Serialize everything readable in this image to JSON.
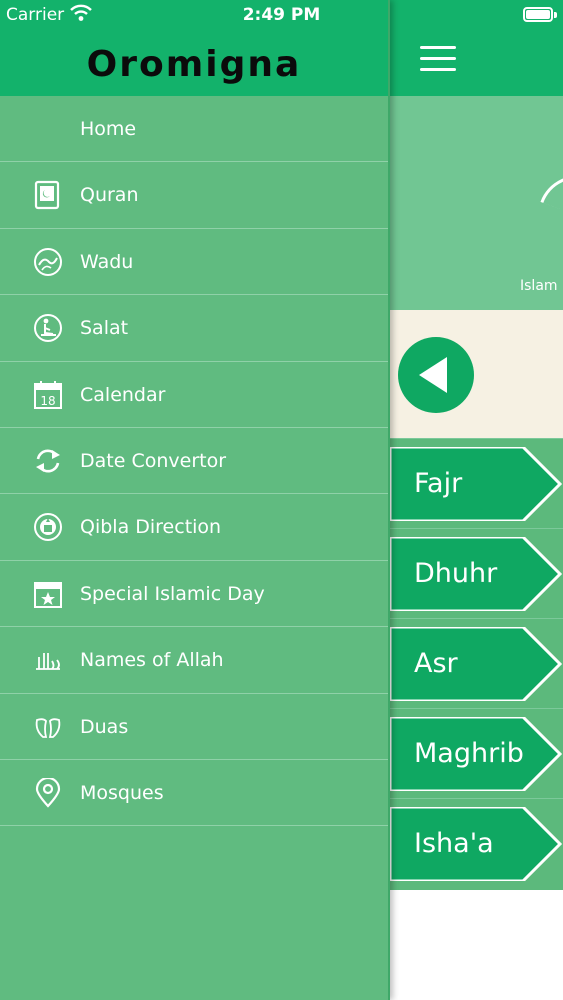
{
  "status_bar": {
    "carrier": "Carrier",
    "time": "2:49 PM"
  },
  "drawer": {
    "logo": "Oromigna",
    "items": [
      {
        "label": "Home",
        "icon": "home-icon"
      },
      {
        "label": "Quran",
        "icon": "quran-book-icon"
      },
      {
        "label": "Wadu",
        "icon": "wadu-icon"
      },
      {
        "label": "Salat",
        "icon": "salat-icon"
      },
      {
        "label": "Calendar",
        "icon": "calendar-icon"
      },
      {
        "label": "Date Convertor",
        "icon": "convert-arrows-icon"
      },
      {
        "label": "Qibla Direction",
        "icon": "qibla-icon"
      },
      {
        "label": "Special Islamic Day",
        "icon": "special-day-icon"
      },
      {
        "label": "Names of Allah",
        "icon": "allah-calligraphy-icon"
      },
      {
        "label": "Duas",
        "icon": "dua-hands-icon"
      },
      {
        "label": "Mosques",
        "icon": "location-pin-icon"
      }
    ],
    "calendar_day": "18"
  },
  "main": {
    "hero_label": "Islam",
    "prayers": [
      "Fajr",
      "Dhuhr",
      "Asr",
      "Maghrib",
      "Isha'a"
    ]
  },
  "colors": {
    "header_green": "#13b26b",
    "drawer_green": "#60bb80",
    "prayer_button": "#0fa862",
    "date_band": "#f6f1e3"
  }
}
